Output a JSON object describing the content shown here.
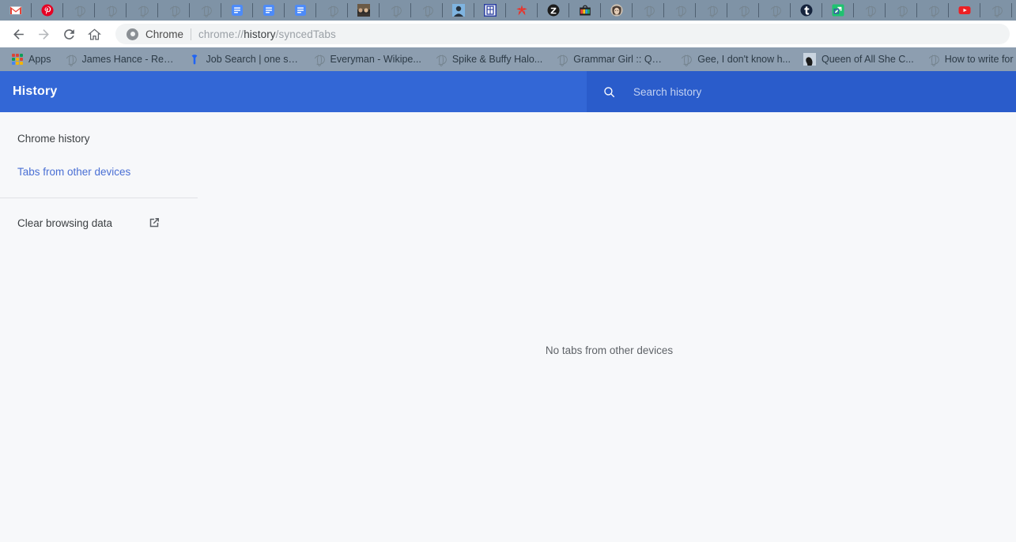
{
  "browser": {
    "tabs": [
      {
        "name": "gmail-tab",
        "icon": "gmail-icon"
      },
      {
        "name": "pinterest-tab",
        "icon": "pinterest-icon"
      },
      {
        "name": "generic-tab-1",
        "icon": "globe-icon"
      },
      {
        "name": "generic-tab-2",
        "icon": "globe-icon"
      },
      {
        "name": "generic-tab-3",
        "icon": "globe-icon"
      },
      {
        "name": "generic-tab-4",
        "icon": "globe-icon"
      },
      {
        "name": "generic-tab-5",
        "icon": "globe-icon"
      },
      {
        "name": "docs-tab-1",
        "icon": "google-docs-icon"
      },
      {
        "name": "docs-tab-2",
        "icon": "google-docs-icon"
      },
      {
        "name": "docs-tab-3",
        "icon": "google-docs-icon"
      },
      {
        "name": "generic-tab-6",
        "icon": "globe-icon"
      },
      {
        "name": "photo-tab",
        "icon": "photo-thumbnail-icon"
      },
      {
        "name": "generic-tab-7",
        "icon": "globe-icon"
      },
      {
        "name": "generic-tab-8",
        "icon": "globe-icon"
      },
      {
        "name": "profile-photo-tab",
        "icon": "portrait-icon"
      },
      {
        "name": "framed-character-tab",
        "icon": "framed-character-icon"
      },
      {
        "name": "starfish-tab",
        "icon": "red-starfish-icon"
      },
      {
        "name": "zazzle-tab",
        "icon": "zazzle-z-icon"
      },
      {
        "name": "shopping-bag-tab",
        "icon": "shopping-bag-icon"
      },
      {
        "name": "avatar-tab",
        "icon": "avatar-icon"
      },
      {
        "name": "generic-tab-9",
        "icon": "globe-icon"
      },
      {
        "name": "generic-tab-10",
        "icon": "globe-icon"
      },
      {
        "name": "generic-tab-11",
        "icon": "globe-icon"
      },
      {
        "name": "generic-tab-12",
        "icon": "globe-icon"
      },
      {
        "name": "generic-tab-13",
        "icon": "globe-icon"
      },
      {
        "name": "tumblr-tab",
        "icon": "tumblr-icon"
      },
      {
        "name": "green-app-tab",
        "icon": "green-launch-icon"
      },
      {
        "name": "generic-tab-14",
        "icon": "globe-icon"
      },
      {
        "name": "generic-tab-15",
        "icon": "globe-icon"
      },
      {
        "name": "generic-tab-16",
        "icon": "globe-icon"
      },
      {
        "name": "youtube-tab",
        "icon": "youtube-icon"
      },
      {
        "name": "generic-tab-17",
        "icon": "globe-icon"
      },
      {
        "name": "reddit-tab",
        "icon": "reddit-icon"
      }
    ],
    "toolbar": {
      "back_icon": "back-arrow-icon",
      "forward_icon": "forward-arrow-icon",
      "reload_icon": "reload-icon",
      "home_icon": "home-icon"
    },
    "omnibox": {
      "scheme_label": "Chrome",
      "url_prefix": "chrome://",
      "url_bold": "history",
      "url_suffix": "/syncedTabs",
      "full_url": "chrome://history/syncedTabs"
    },
    "bookmarks": {
      "apps_label": "Apps",
      "items": [
        {
          "label": "James Hance - Rele...",
          "icon": "globe-icon"
        },
        {
          "label": "Job Search | one se...",
          "icon": "indeed-icon"
        },
        {
          "label": "Everyman - Wikipe...",
          "icon": "globe-icon"
        },
        {
          "label": "Spike & Buffy Halo...",
          "icon": "globe-icon"
        },
        {
          "label": "Grammar Girl :: Qui...",
          "icon": "globe-icon"
        },
        {
          "label": "Gee, I don't know h...",
          "icon": "globe-icon"
        },
        {
          "label": "Queen of All She C...",
          "icon": "silhouette-icon"
        },
        {
          "label": "How to write for co...",
          "icon": "globe-icon"
        }
      ]
    }
  },
  "history_page": {
    "title": "History",
    "search": {
      "placeholder": "Search history",
      "value": "",
      "icon": "search-icon"
    },
    "sidebar": {
      "items": [
        {
          "label": "Chrome history",
          "active": false
        },
        {
          "label": "Tabs from other devices",
          "active": true
        }
      ],
      "clear_browsing_data": {
        "label": "Clear browsing data",
        "icon": "external-link-icon"
      }
    },
    "main": {
      "empty_message": "No tabs from other devices"
    },
    "colors": {
      "header_blue": "#3367d6",
      "search_blue": "#2a5ccb",
      "active_link": "#4a6fd4",
      "page_background": "#f7f8fa"
    }
  }
}
